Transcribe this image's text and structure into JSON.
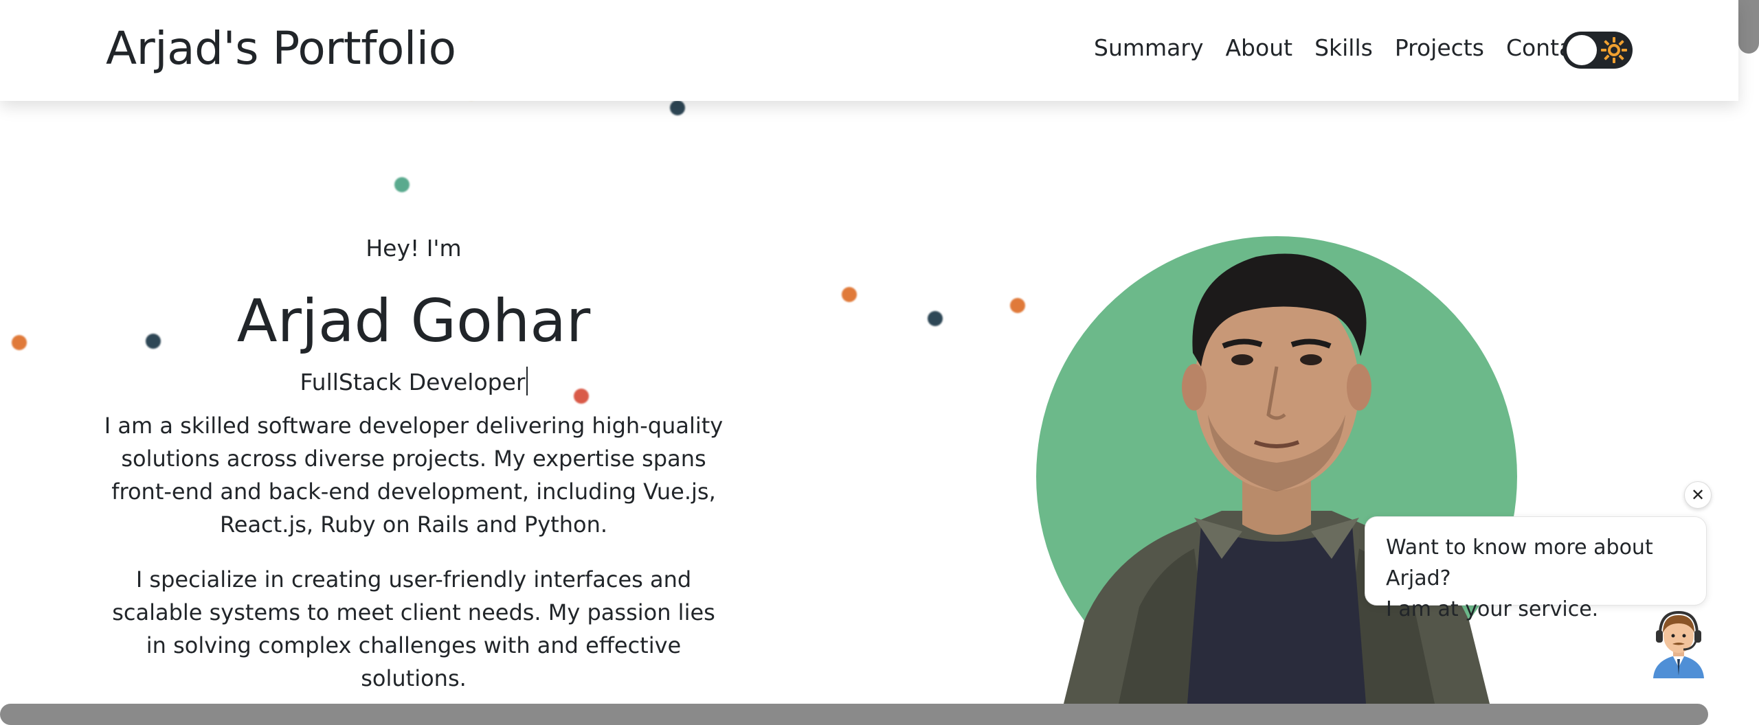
{
  "header": {
    "brand": "Arjad's Portfolio",
    "nav": [
      "Summary",
      "About",
      "Skills",
      "Projects",
      "Contact"
    ]
  },
  "theme_toggle": {
    "state": "light",
    "icon": "sun-icon"
  },
  "hero": {
    "greeting": "Hey! I'm",
    "name": "Arjad Gohar",
    "role": "FullStack Developer",
    "paragraph1": "I am a skilled software developer delivering high-quality solutions across diverse projects. My expertise spans front-end and back-end development, including Vue.js, React.js, Ruby on Rails and Python.",
    "paragraph2": "I specialize in creating user-friendly interfaces and scalable systems to meet client needs. My passion lies in solving complex challenges with and effective solutions."
  },
  "chat": {
    "line1": "Want to know more about Arjad?",
    "line2": "I am at your service.",
    "close_icon": "close-icon",
    "bot_icon": "support-agent-icon"
  },
  "colors": {
    "avatar_circle": "#6cb98a",
    "toggle_bg": "#212529",
    "sun": "#f0a030",
    "scrollbar": "#8a8a8a"
  }
}
